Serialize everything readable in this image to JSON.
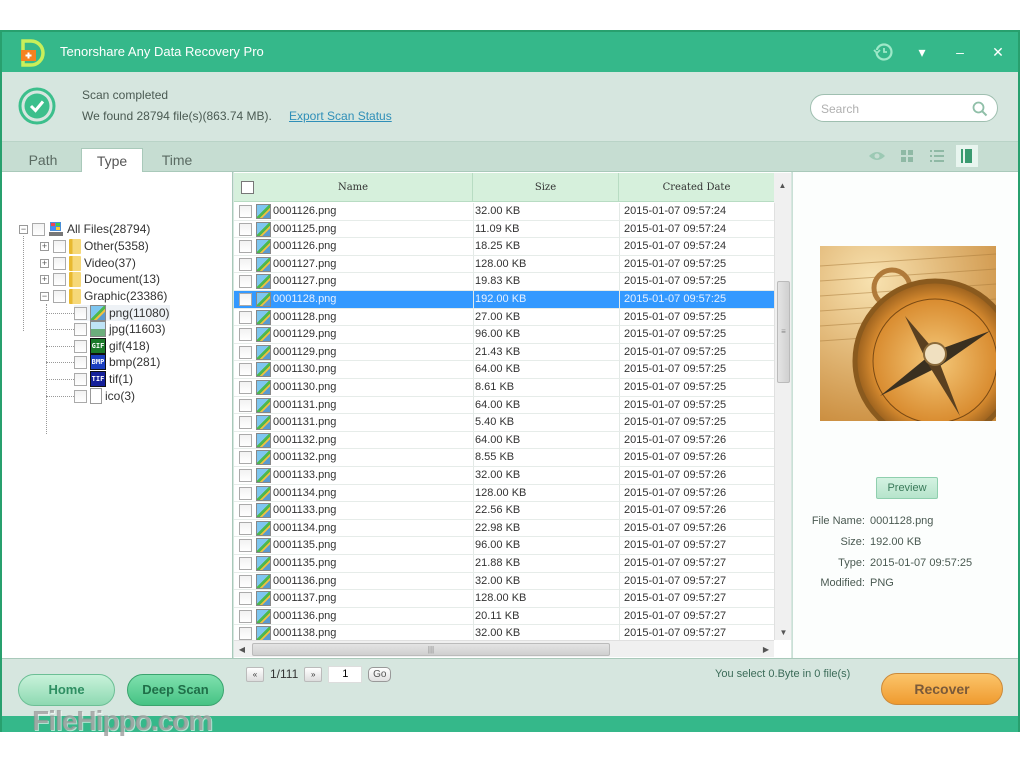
{
  "app": {
    "title": "Tenorshare Any Data Recovery Pro",
    "window_controls": [
      "history-icon",
      "dropdown-icon",
      "minimize-icon",
      "close-icon"
    ]
  },
  "status": {
    "title": "Scan completed",
    "found": "We found 28794 file(s)(863.74 MB).",
    "export_link": "Export Scan Status"
  },
  "search": {
    "placeholder": "Search",
    "value": ""
  },
  "tabs": [
    {
      "label": "Path",
      "active": false
    },
    {
      "label": "Type",
      "active": true
    },
    {
      "label": "Time",
      "active": false
    }
  ],
  "view_modes": [
    "preview-eye-icon",
    "grid-view-icon",
    "list-view-icon",
    "detail-view-icon"
  ],
  "tree": {
    "root": {
      "label": "All Files(28794)",
      "expanded": true
    },
    "categories": [
      {
        "label": "Other(5358)",
        "expanded": false
      },
      {
        "label": "Video(37)",
        "expanded": false
      },
      {
        "label": "Document(13)",
        "expanded": false
      },
      {
        "label": "Graphic(23386)",
        "expanded": true
      }
    ],
    "graphic_children": [
      {
        "label": "png(11080)",
        "icon": "png",
        "selected": true
      },
      {
        "label": "jpg(11603)",
        "icon": "jpg"
      },
      {
        "label": "gif(418)",
        "icon": "GIF"
      },
      {
        "label": "bmp(281)",
        "icon": "BMP"
      },
      {
        "label": "tif(1)",
        "icon": "TIF"
      },
      {
        "label": "ico(3)",
        "icon": "blank"
      }
    ]
  },
  "table": {
    "columns": [
      "Name",
      "Size",
      "Created Date"
    ],
    "selected_index": 5,
    "rows": [
      {
        "name": "0001126.png",
        "size": "32.00 KB",
        "date": "2015-01-07 09:57:24"
      },
      {
        "name": "0001125.png",
        "size": "11.09 KB",
        "date": "2015-01-07 09:57:24"
      },
      {
        "name": "0001126.png",
        "size": "18.25 KB",
        "date": "2015-01-07 09:57:24"
      },
      {
        "name": "0001127.png",
        "size": "128.00 KB",
        "date": "2015-01-07 09:57:25"
      },
      {
        "name": "0001127.png",
        "size": "19.83 KB",
        "date": "2015-01-07 09:57:25"
      },
      {
        "name": "0001128.png",
        "size": "192.00 KB",
        "date": "2015-01-07 09:57:25"
      },
      {
        "name": "0001128.png",
        "size": "27.00 KB",
        "date": "2015-01-07 09:57:25"
      },
      {
        "name": "0001129.png",
        "size": "96.00 KB",
        "date": "2015-01-07 09:57:25"
      },
      {
        "name": "0001129.png",
        "size": "21.43 KB",
        "date": "2015-01-07 09:57:25"
      },
      {
        "name": "0001130.png",
        "size": "64.00 KB",
        "date": "2015-01-07 09:57:25"
      },
      {
        "name": "0001130.png",
        "size": "8.61 KB",
        "date": "2015-01-07 09:57:25"
      },
      {
        "name": "0001131.png",
        "size": "64.00 KB",
        "date": "2015-01-07 09:57:25"
      },
      {
        "name": "0001131.png",
        "size": "5.40 KB",
        "date": "2015-01-07 09:57:25"
      },
      {
        "name": "0001132.png",
        "size": "64.00 KB",
        "date": "2015-01-07 09:57:26"
      },
      {
        "name": "0001132.png",
        "size": "8.55 KB",
        "date": "2015-01-07 09:57:26"
      },
      {
        "name": "0001133.png",
        "size": "32.00 KB",
        "date": "2015-01-07 09:57:26"
      },
      {
        "name": "0001134.png",
        "size": "128.00 KB",
        "date": "2015-01-07 09:57:26"
      },
      {
        "name": "0001133.png",
        "size": "22.56 KB",
        "date": "2015-01-07 09:57:26"
      },
      {
        "name": "0001134.png",
        "size": "22.98 KB",
        "date": "2015-01-07 09:57:26"
      },
      {
        "name": "0001135.png",
        "size": "96.00 KB",
        "date": "2015-01-07 09:57:27"
      },
      {
        "name": "0001135.png",
        "size": "21.88 KB",
        "date": "2015-01-07 09:57:27"
      },
      {
        "name": "0001136.png",
        "size": "32.00 KB",
        "date": "2015-01-07 09:57:27"
      },
      {
        "name": "0001137.png",
        "size": "128.00 KB",
        "date": "2015-01-07 09:57:27"
      },
      {
        "name": "0001136.png",
        "size": "20.11 KB",
        "date": "2015-01-07 09:57:27"
      },
      {
        "name": "0001138.png",
        "size": "32.00 KB",
        "date": "2015-01-07 09:57:27"
      }
    ]
  },
  "preview": {
    "button_label": "Preview",
    "image_description": "compass on newspaper",
    "info": [
      {
        "label": "File Name:",
        "value": "0001128.png"
      },
      {
        "label": "Size:",
        "value": "192.00 KB"
      },
      {
        "label": "Type:",
        "value": "2015-01-07 09:57:25"
      },
      {
        "label": "Modified:",
        "value": "PNG"
      }
    ]
  },
  "footer": {
    "home_label": "Home",
    "deep_scan_label": "Deep Scan",
    "pager": {
      "first_icon": "«",
      "page_text": "1/111",
      "last_icon": "»",
      "page_input": "1",
      "go_label": "Go"
    },
    "select_status": "You select 0.Byte in 0 file(s)",
    "recover_label": "Recover"
  },
  "watermark": "FileHippo.com",
  "colors": {
    "brand_green": "#35b88a",
    "selection_blue": "#3399ff",
    "recover_orange": "#ef9b2f"
  }
}
